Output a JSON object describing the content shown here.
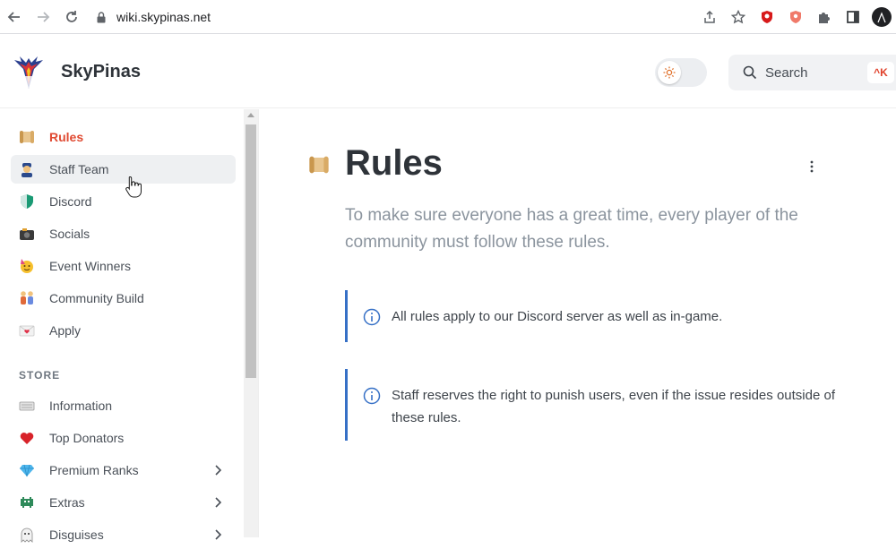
{
  "browser": {
    "url": "wiki.skypinas.net"
  },
  "header": {
    "brand": "SkyPinas",
    "search_label": "Search",
    "search_shortcut": "^K"
  },
  "sidebar": {
    "items": [
      {
        "label": "Rules",
        "icon": "scroll-icon"
      },
      {
        "label": "Staff Team",
        "icon": "police-officer-icon"
      },
      {
        "label": "Discord",
        "icon": "shield-icon"
      },
      {
        "label": "Socials",
        "icon": "camera-icon"
      },
      {
        "label": "Event Winners",
        "icon": "party-face-icon"
      },
      {
        "label": "Community Build",
        "icon": "people-holding-hands-icon"
      },
      {
        "label": "Apply",
        "icon": "love-letter-icon"
      }
    ],
    "store_title": "STORE",
    "store_items": [
      {
        "label": "Information",
        "icon": "keyboard-icon"
      },
      {
        "label": "Top Donators",
        "icon": "heart-icon"
      },
      {
        "label": "Premium Ranks",
        "icon": "gem-icon"
      },
      {
        "label": "Extras",
        "icon": "space-invader-icon"
      },
      {
        "label": "Disguises",
        "icon": "ghost-icon"
      }
    ]
  },
  "main": {
    "title": "Rules",
    "lead": "To make sure everyone has a great time, every player of the community must follow these rules.",
    "hints": [
      "All rules apply to our Discord server as well as in-game.",
      "Staff reserves the right to punish users, even if the issue resides outside of these rules."
    ]
  },
  "colors": {
    "accent": "#e04a32",
    "hint_border": "#3670c6"
  }
}
